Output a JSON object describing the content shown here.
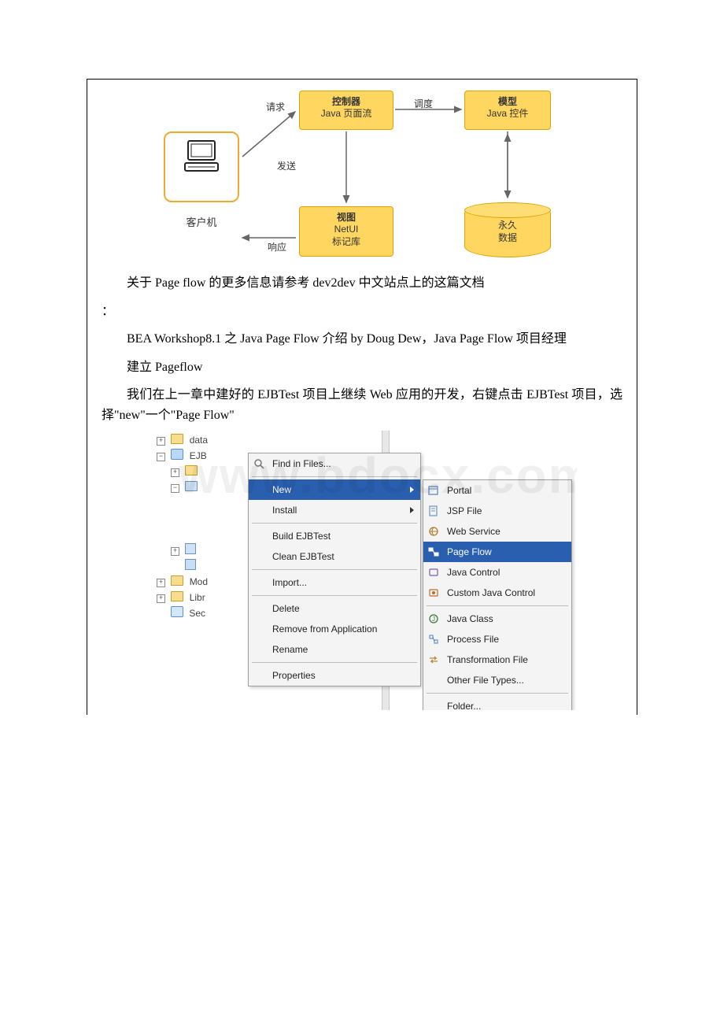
{
  "diagram": {
    "controller_title": "控制器",
    "controller_sub": "Java 页面流",
    "model_title": "模型",
    "model_sub": "Java 控件",
    "view_title": "视图",
    "view_sub1": "NetUI",
    "view_sub2": "标记库",
    "client_label": "客户机",
    "db_line1": "永久",
    "db_line2": "数据",
    "lbl_request": "请求",
    "lbl_dispatch": "调度",
    "lbl_send": "发送",
    "lbl_response": "响应"
  },
  "paragraphs": {
    "p1": "关于 Page flow 的更多信息请参考 dev2dev 中文站点上的这篇文档",
    "colon": "：",
    "p2": "BEA Workshop8.1 之 Java Page Flow 介绍 by Doug Dew，Java Page Flow 项目经理",
    "p3": "建立 Pageflow",
    "p4": "我们在上一章中建好的 EJBTest 项目上继续 Web 应用的开发，右键点击 EJBTest 项目，选择\"new\"一个\"Page Flow\""
  },
  "tree": {
    "n0": "data",
    "n1": "EJB",
    "n5": "Mod",
    "n6": "Libr",
    "n7": "Sec"
  },
  "menu1": {
    "find": "Find in Files...",
    "new": "New",
    "install": "Install",
    "build": "Build EJBTest",
    "clean": "Clean EJBTest",
    "import": "Import...",
    "delete": "Delete",
    "remove": "Remove from Application",
    "rename": "Rename",
    "properties": "Properties"
  },
  "menu2": {
    "portal": "Portal",
    "jsp": "JSP File",
    "ws": "Web Service",
    "pageflow": "Page Flow",
    "jctrl": "Java Control",
    "cctrl": "Custom Java Control",
    "jclass": "Java Class",
    "process": "Process File",
    "transform": "Transformation File",
    "other": "Other File Types...",
    "folder": "Folder..."
  },
  "watermark": "www.bdocx.com"
}
